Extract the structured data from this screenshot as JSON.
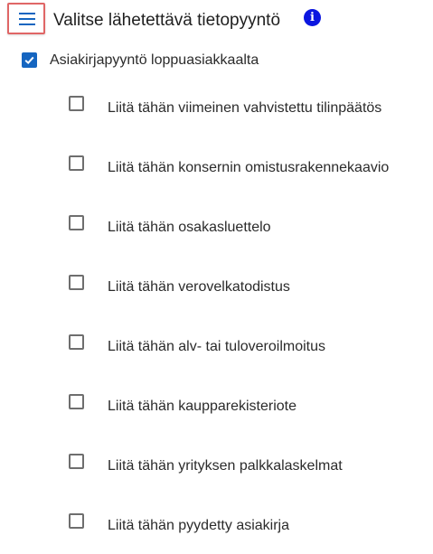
{
  "header": {
    "menu_icon": "hamburger-menu-icon",
    "title": "Valitse lähetettävä tietopyyntö",
    "info_icon": "info-icon",
    "info_glyph": "i",
    "info_color": "#0b16e0",
    "menu_highlight_color": "#e06666"
  },
  "request": {
    "label": "Asiakirjapyyntö loppuasiakkaalta",
    "checked": true,
    "check_color": "#1565c0"
  },
  "attachments": [
    {
      "label": "Liitä tähän viimeinen vahvistettu tilinpäätös",
      "checked": false
    },
    {
      "label": "Liitä tähän konsernin omistusrakennekaavio",
      "checked": false
    },
    {
      "label": "Liitä tähän osakasluettelo",
      "checked": false
    },
    {
      "label": "Liitä tähän verovelkatodistus",
      "checked": false
    },
    {
      "label": "Liitä tähän alv- tai tuloveroilmoitus",
      "checked": false
    },
    {
      "label": "Liitä tähän kaupparekisteriote",
      "checked": false
    },
    {
      "label": "Liitä tähän yrityksen palkkalaskelmat",
      "checked": false
    },
    {
      "label": "Liitä tähän pyydetty asiakirja",
      "checked": false
    }
  ]
}
